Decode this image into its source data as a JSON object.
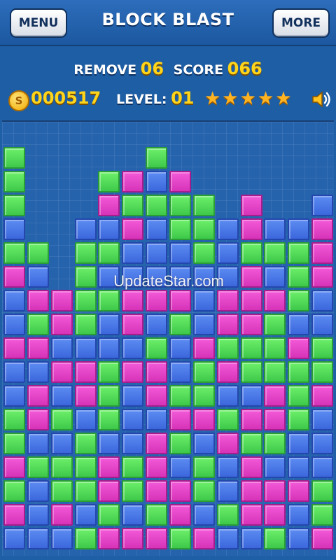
{
  "header": {
    "menu_label": "MENU",
    "title": "BLOCK BLAST",
    "more_label": "MORE"
  },
  "hud": {
    "remove_label": "REMOVE",
    "remove_value": "06",
    "score_label": "SCORE",
    "score_value": "066",
    "coins_value": "000517",
    "coin_icon_glyph": "S",
    "level_label": "LEVEL:",
    "level_value": "01",
    "stars_display": "★★★★★",
    "star_count": 5,
    "sound_icon": "speaker-icon"
  },
  "watermark": "UpdateStar.com",
  "colors": {
    "g": "#4fd85a",
    "p": "#e444c8",
    "b": "#4a78e6"
  },
  "board": {
    "columns": 14,
    "rows": 17,
    "column_heights": [
      17,
      14,
      11,
      14,
      15,
      17,
      16,
      16,
      15,
      12,
      15,
      14,
      14,
      15
    ],
    "grid": [
      "g.....g.......",
      "g...gpbp......",
      "g...pgggg.p..b",
      "b..bbpbggbpbbp",
      "gg.ggbbbgbgggp",
      "pb.gbbbbbbpbgp",
      "bppggpppbpppgb",
      "bgpgbpbgbppgbb",
      "ppbbbbgbpgggpg",
      "bbppgppbgpgggg",
      "bpbpgbpggbbpgp",
      "gpgbgbbppgppgb",
      "gbbgbbpgbpggbb",
      "pgggpgpbgbpbbb",
      "gbggpgppgbpppg",
      "pbpbgbgpbgppbg",
      "bbbgpppgpbbgbp"
    ]
  }
}
